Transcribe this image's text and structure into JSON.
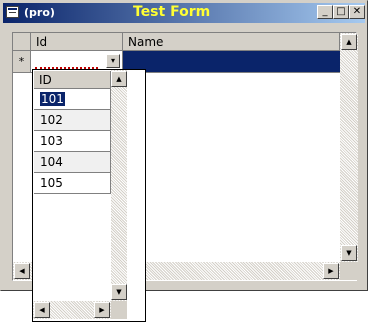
{
  "window": {
    "title": "(pro)",
    "center_title": "Test Form"
  },
  "titlebar_buttons": {
    "minimize": "_",
    "maximize": "□",
    "close": "✕"
  },
  "grid": {
    "columns": [
      "Id",
      "Name"
    ],
    "new_row_marker": "*",
    "current_row": {
      "id": "",
      "name": ""
    }
  },
  "dropdown": {
    "header": "ID",
    "items": [
      "101",
      "102",
      "103",
      "104",
      "105"
    ],
    "selected": "101"
  },
  "icons": {
    "dropdown_arrow": "▾",
    "scroll_up": "▲",
    "scroll_down": "▼",
    "scroll_left": "◀",
    "scroll_right": "▶"
  },
  "colors": {
    "selection": "#0a246a",
    "title_accent": "#ffff33",
    "face": "#d4d0c8"
  }
}
